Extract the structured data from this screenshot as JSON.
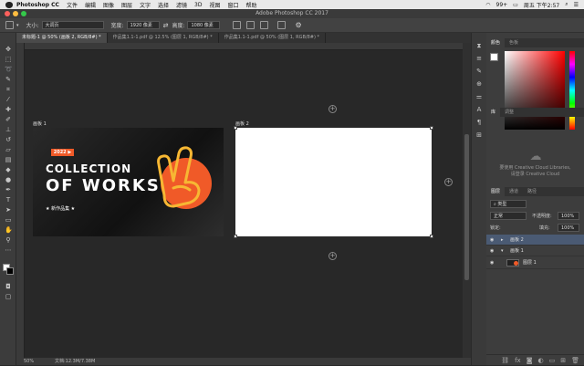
{
  "menubar": {
    "app": "Photoshop CC",
    "items": [
      "文件",
      "编辑",
      "图像",
      "图层",
      "文字",
      "选择",
      "滤镜",
      "3D",
      "视图",
      "窗口",
      "帮助"
    ],
    "battery": "99+",
    "clock": "周五 下午2:57"
  },
  "window": {
    "title": "Adobe Photoshop CC 2017"
  },
  "options": {
    "size_label": "大小:",
    "size_value": "大调页",
    "width_label": "宽度:",
    "width_value": "1920 像素",
    "height_label": "高度:",
    "height_value": "1080 像素"
  },
  "tabs": [
    "未标题-1 @ 50% (画板 2, RGB/8#) *",
    "作品集1.1-1.pdf @ 12.5% (图层 1, RGB/8#) *",
    "作品集1.1-1.pdf @ 50% (图层 1, RGB/8#) *"
  ],
  "artboards": {
    "ab1_label": "画板 1",
    "ab2_label": "画板 2",
    "ab1_badge": "2022 ▶",
    "ab1_line1": "COLLECTION",
    "ab1_line2": "OF WORKS",
    "ab1_tag": "★ 新作品集 ★"
  },
  "status": {
    "zoom": "50%",
    "doc": "文档:12.3M/7.38M"
  },
  "panels": {
    "color_tabs": [
      "颜色",
      "色板"
    ],
    "lib_tabs": [
      "库",
      "调整"
    ],
    "lib_msg1": "要使用 Creative Cloud Libraries,",
    "lib_msg2": "请登录 Creative Cloud",
    "layer_tabs": [
      "图层",
      "通道",
      "路径"
    ],
    "kind_label": "类型",
    "blend_mode": "正常",
    "opacity_label": "不透明度:",
    "opacity_value": "100%",
    "lock_label": "锁定:",
    "fill_label": "填充:",
    "fill_value": "100%",
    "layers": [
      "画板 2",
      "画板 1",
      "图层 1"
    ]
  },
  "colors": {
    "accent": "#f05a28",
    "selected_layer": "#4a5a73",
    "artboard2": "#ffffff"
  }
}
